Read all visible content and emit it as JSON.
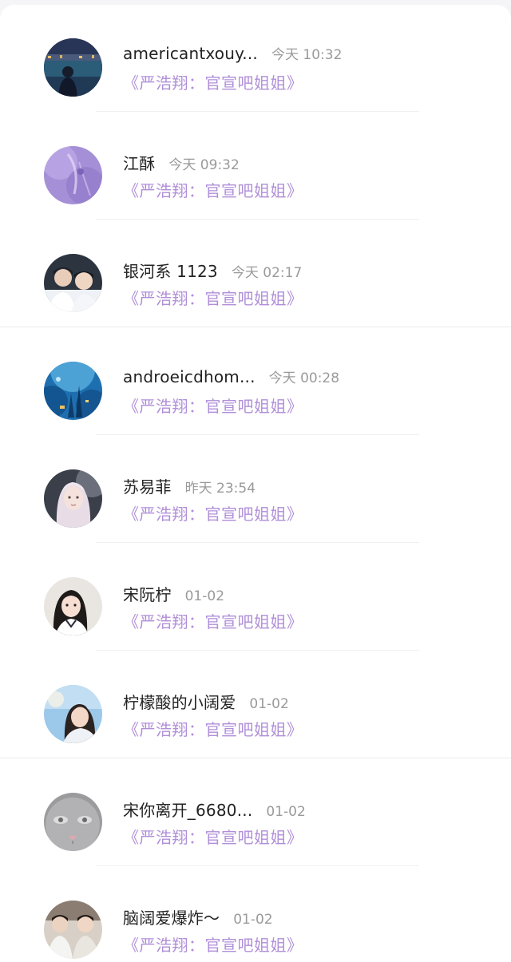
{
  "comments": [
    {
      "name": "americantxouy...",
      "time": "今天 10:32",
      "message": "《严浩翔：官宣吧姐姐》",
      "avatar_icon": "night-city-photo-avatar"
    },
    {
      "name": "江酥",
      "time": "今天 09:32",
      "message": "《严浩翔：官宣吧姐姐》",
      "avatar_icon": "purple-anime-avatar"
    },
    {
      "name": "银河系 1123",
      "time": "今天 02:17",
      "message": "《严浩翔：官宣吧姐姐》",
      "avatar_icon": "boys-photo-avatar"
    },
    {
      "name": "androeicdhom...",
      "time": "今天 00:28",
      "message": "《严浩翔：官宣吧姐姐》",
      "avatar_icon": "blue-aquarium-avatar"
    },
    {
      "name": "苏易菲",
      "time": "昨天 23:54",
      "message": "《严浩翔：官宣吧姐姐》",
      "avatar_icon": "girl-portrait-avatar"
    },
    {
      "name": "宋阮柠",
      "time": "01-02",
      "message": "《严浩翔：官宣吧姐姐》",
      "avatar_icon": "girl-uniform-avatar"
    },
    {
      "name": "柠檬酸的小阔爱",
      "time": "01-02",
      "message": "《严浩翔：官宣吧姐姐》",
      "avatar_icon": "girl-sky-avatar"
    },
    {
      "name": "宋你离开_6680...",
      "time": "01-02",
      "message": "《严浩翔：官宣吧姐姐》",
      "avatar_icon": "grey-cat-avatar"
    },
    {
      "name": "脑阔爱爆炸～",
      "time": "01-02",
      "message": "《严浩翔：官宣吧姐姐》",
      "avatar_icon": "group-photo-avatar"
    }
  ],
  "colors": {
    "name": "#222222",
    "time": "#9a9a9a",
    "message": "#b08fd9",
    "background": "#ffffff"
  }
}
